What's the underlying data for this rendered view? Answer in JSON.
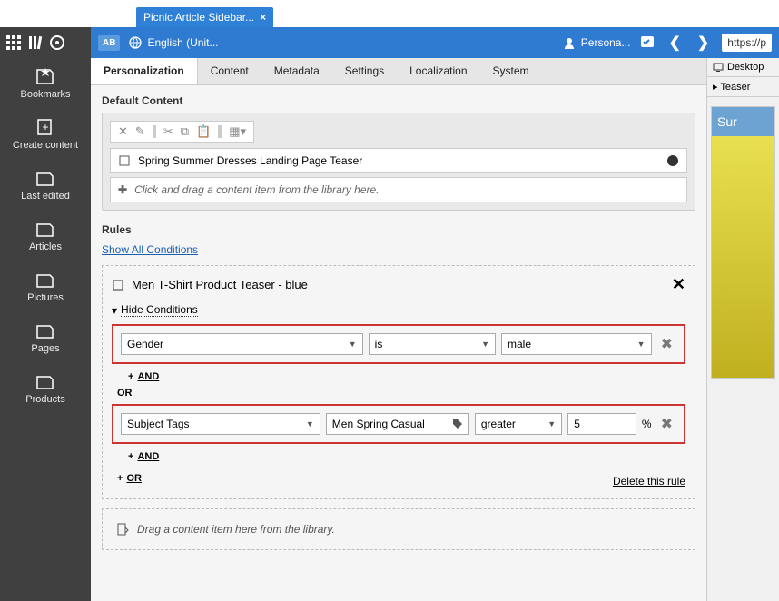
{
  "file_tab": "Picnic Article Sidebar...",
  "sidebar": {
    "items": [
      "Bookmarks",
      "Create content",
      "Last edited",
      "Articles",
      "Pictures",
      "Pages",
      "Products"
    ]
  },
  "bluebar": {
    "ab": "AB",
    "language": "English (Unit...",
    "persona": "Persona...",
    "url": "https://p"
  },
  "tabs": [
    "Personalization",
    "Content",
    "Metadata",
    "Settings",
    "Localization",
    "System"
  ],
  "default_content": {
    "title": "Default Content",
    "item": "Spring Summer Dresses Landing Page Teaser",
    "hint": "Click and drag a content item from the library here."
  },
  "rules_section": {
    "title": "Rules",
    "show_all": "Show All Conditions"
  },
  "rule": {
    "name": "Men T-Shirt Product Teaser - blue",
    "hide_conditions": "Hide Conditions",
    "cond1": {
      "field": "Gender",
      "op": "is",
      "value": "male"
    },
    "and": "AND",
    "or": "OR",
    "cond2": {
      "field": "Subject Tags",
      "tag": "Men Spring Casual",
      "op": "greater",
      "value": "5",
      "pct": "%"
    },
    "and2": "AND",
    "or2": "OR",
    "delete": "Delete this rule"
  },
  "drag_hint": "Drag a content item here from the library.",
  "preview": {
    "device": "Desktop",
    "section": "Teaser",
    "banner": "Sur"
  }
}
